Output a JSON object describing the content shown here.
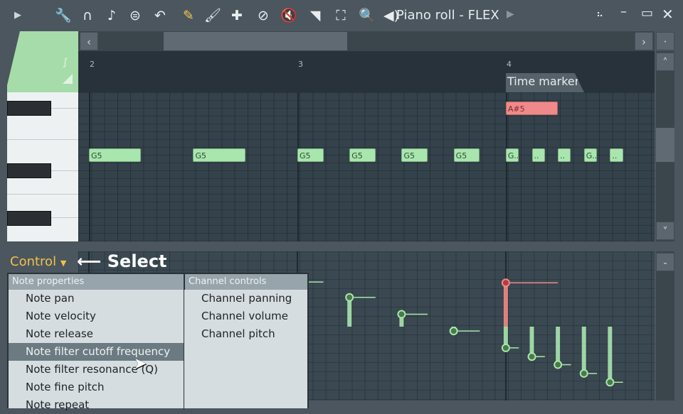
{
  "toolbar": {
    "icons": [
      "play-arrow-icon",
      "wrench-icon",
      "magnet-icon",
      "note-icon",
      "menu-circle-icon",
      "undo-icon",
      "pencil-icon",
      "paint-brush-icon",
      "paint-brush-plus-icon",
      "delete-circle-icon",
      "mute-icon",
      "slice-icon",
      "select-icon",
      "zoom-icon",
      "playback-icon"
    ],
    "title": "Piano roll - FLEX",
    "active_tool_color": "#f2c94c"
  },
  "ruler": {
    "bars": [
      "2",
      "3",
      "4"
    ],
    "time_marker": "Time marker"
  },
  "notes": [
    {
      "label": "G5",
      "start": 0,
      "length": 4,
      "row": "G5",
      "value": 0.6
    },
    {
      "label": "G5",
      "start": 8,
      "length": 4,
      "row": "G5",
      "value": 0.6
    },
    {
      "label": "G5",
      "start": 16,
      "length": 2,
      "row": "G5",
      "value": 0.61
    },
    {
      "label": "G5",
      "start": 20,
      "length": 2,
      "row": "G5",
      "value": 0.4
    },
    {
      "label": "G5",
      "start": 24,
      "length": 2,
      "row": "G5",
      "value": 0.17
    },
    {
      "label": "G5",
      "start": 28,
      "length": 2,
      "row": "G5",
      "value": -0.06
    },
    {
      "label": "A#5",
      "start": 32,
      "length": 4,
      "row": "A#5",
      "value": 0.6,
      "selected": true
    },
    {
      "label": "G..",
      "start": 32,
      "length": 1,
      "row": "G5",
      "value": -0.29
    },
    {
      "label": "..",
      "start": 34,
      "length": 1,
      "row": "G5",
      "value": -0.41
    },
    {
      "label": "..",
      "start": 36,
      "length": 1,
      "row": "G5",
      "value": -0.52
    },
    {
      "label": "G..",
      "start": 38,
      "length": 1,
      "row": "G5",
      "value": -0.64
    },
    {
      "label": "..",
      "start": 40,
      "length": 1,
      "row": "G5",
      "value": -0.76
    }
  ],
  "colors": {
    "note": "#a8e6ae",
    "selected_note": "#f08a8a"
  },
  "control": {
    "label": "Control",
    "annotation": "Select"
  },
  "menu": {
    "left_header": "Note properties",
    "left": [
      "Note pan",
      "Note velocity",
      "Note release",
      "Note filter cutoff frequency",
      "Note filter resonance (Q)",
      "Note fine pitch",
      "Note repeat"
    ],
    "highlighted": "Note filter cutoff frequency",
    "right_header": "Channel controls",
    "right": [
      "Channel panning",
      "Channel volume",
      "Channel pitch"
    ]
  }
}
